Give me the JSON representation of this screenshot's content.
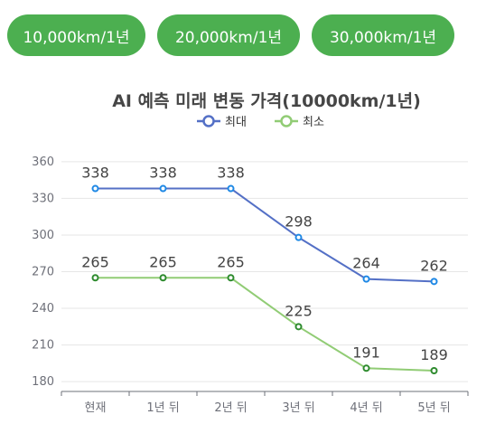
{
  "colors": {
    "button_bg": "#4caf50",
    "max_series": "#5470c6",
    "max_point": "#1e88e5",
    "min_series": "#91cc75",
    "min_point": "#2e8b2e",
    "axis": "#6e7079",
    "grid": "#e6e6e6",
    "title": "#464646",
    "label": "#444444"
  },
  "buttons": [
    {
      "label": "10,000km/1년",
      "width": 153
    },
    {
      "label": "20,000km/1년",
      "width": 158
    },
    {
      "label": "30,000km/1년",
      "width": 158
    }
  ],
  "chart_data": {
    "type": "line",
    "title": "AI 예측 미래 변동 가격(10000km/1년)",
    "categories": [
      "현재",
      "1년 뒤",
      "2년 뒤",
      "3년 뒤",
      "4년 뒤",
      "5년 뒤"
    ],
    "series": [
      {
        "name": "최대",
        "values": [
          338,
          338,
          338,
          298,
          264,
          262
        ]
      },
      {
        "name": "최소",
        "values": [
          265,
          265,
          265,
          225,
          191,
          189
        ]
      }
    ],
    "y_ticks": [
      180,
      210,
      240,
      270,
      300,
      330,
      360
    ],
    "ylim": [
      172,
      368
    ],
    "grid": true,
    "legend_position": "top-center"
  }
}
